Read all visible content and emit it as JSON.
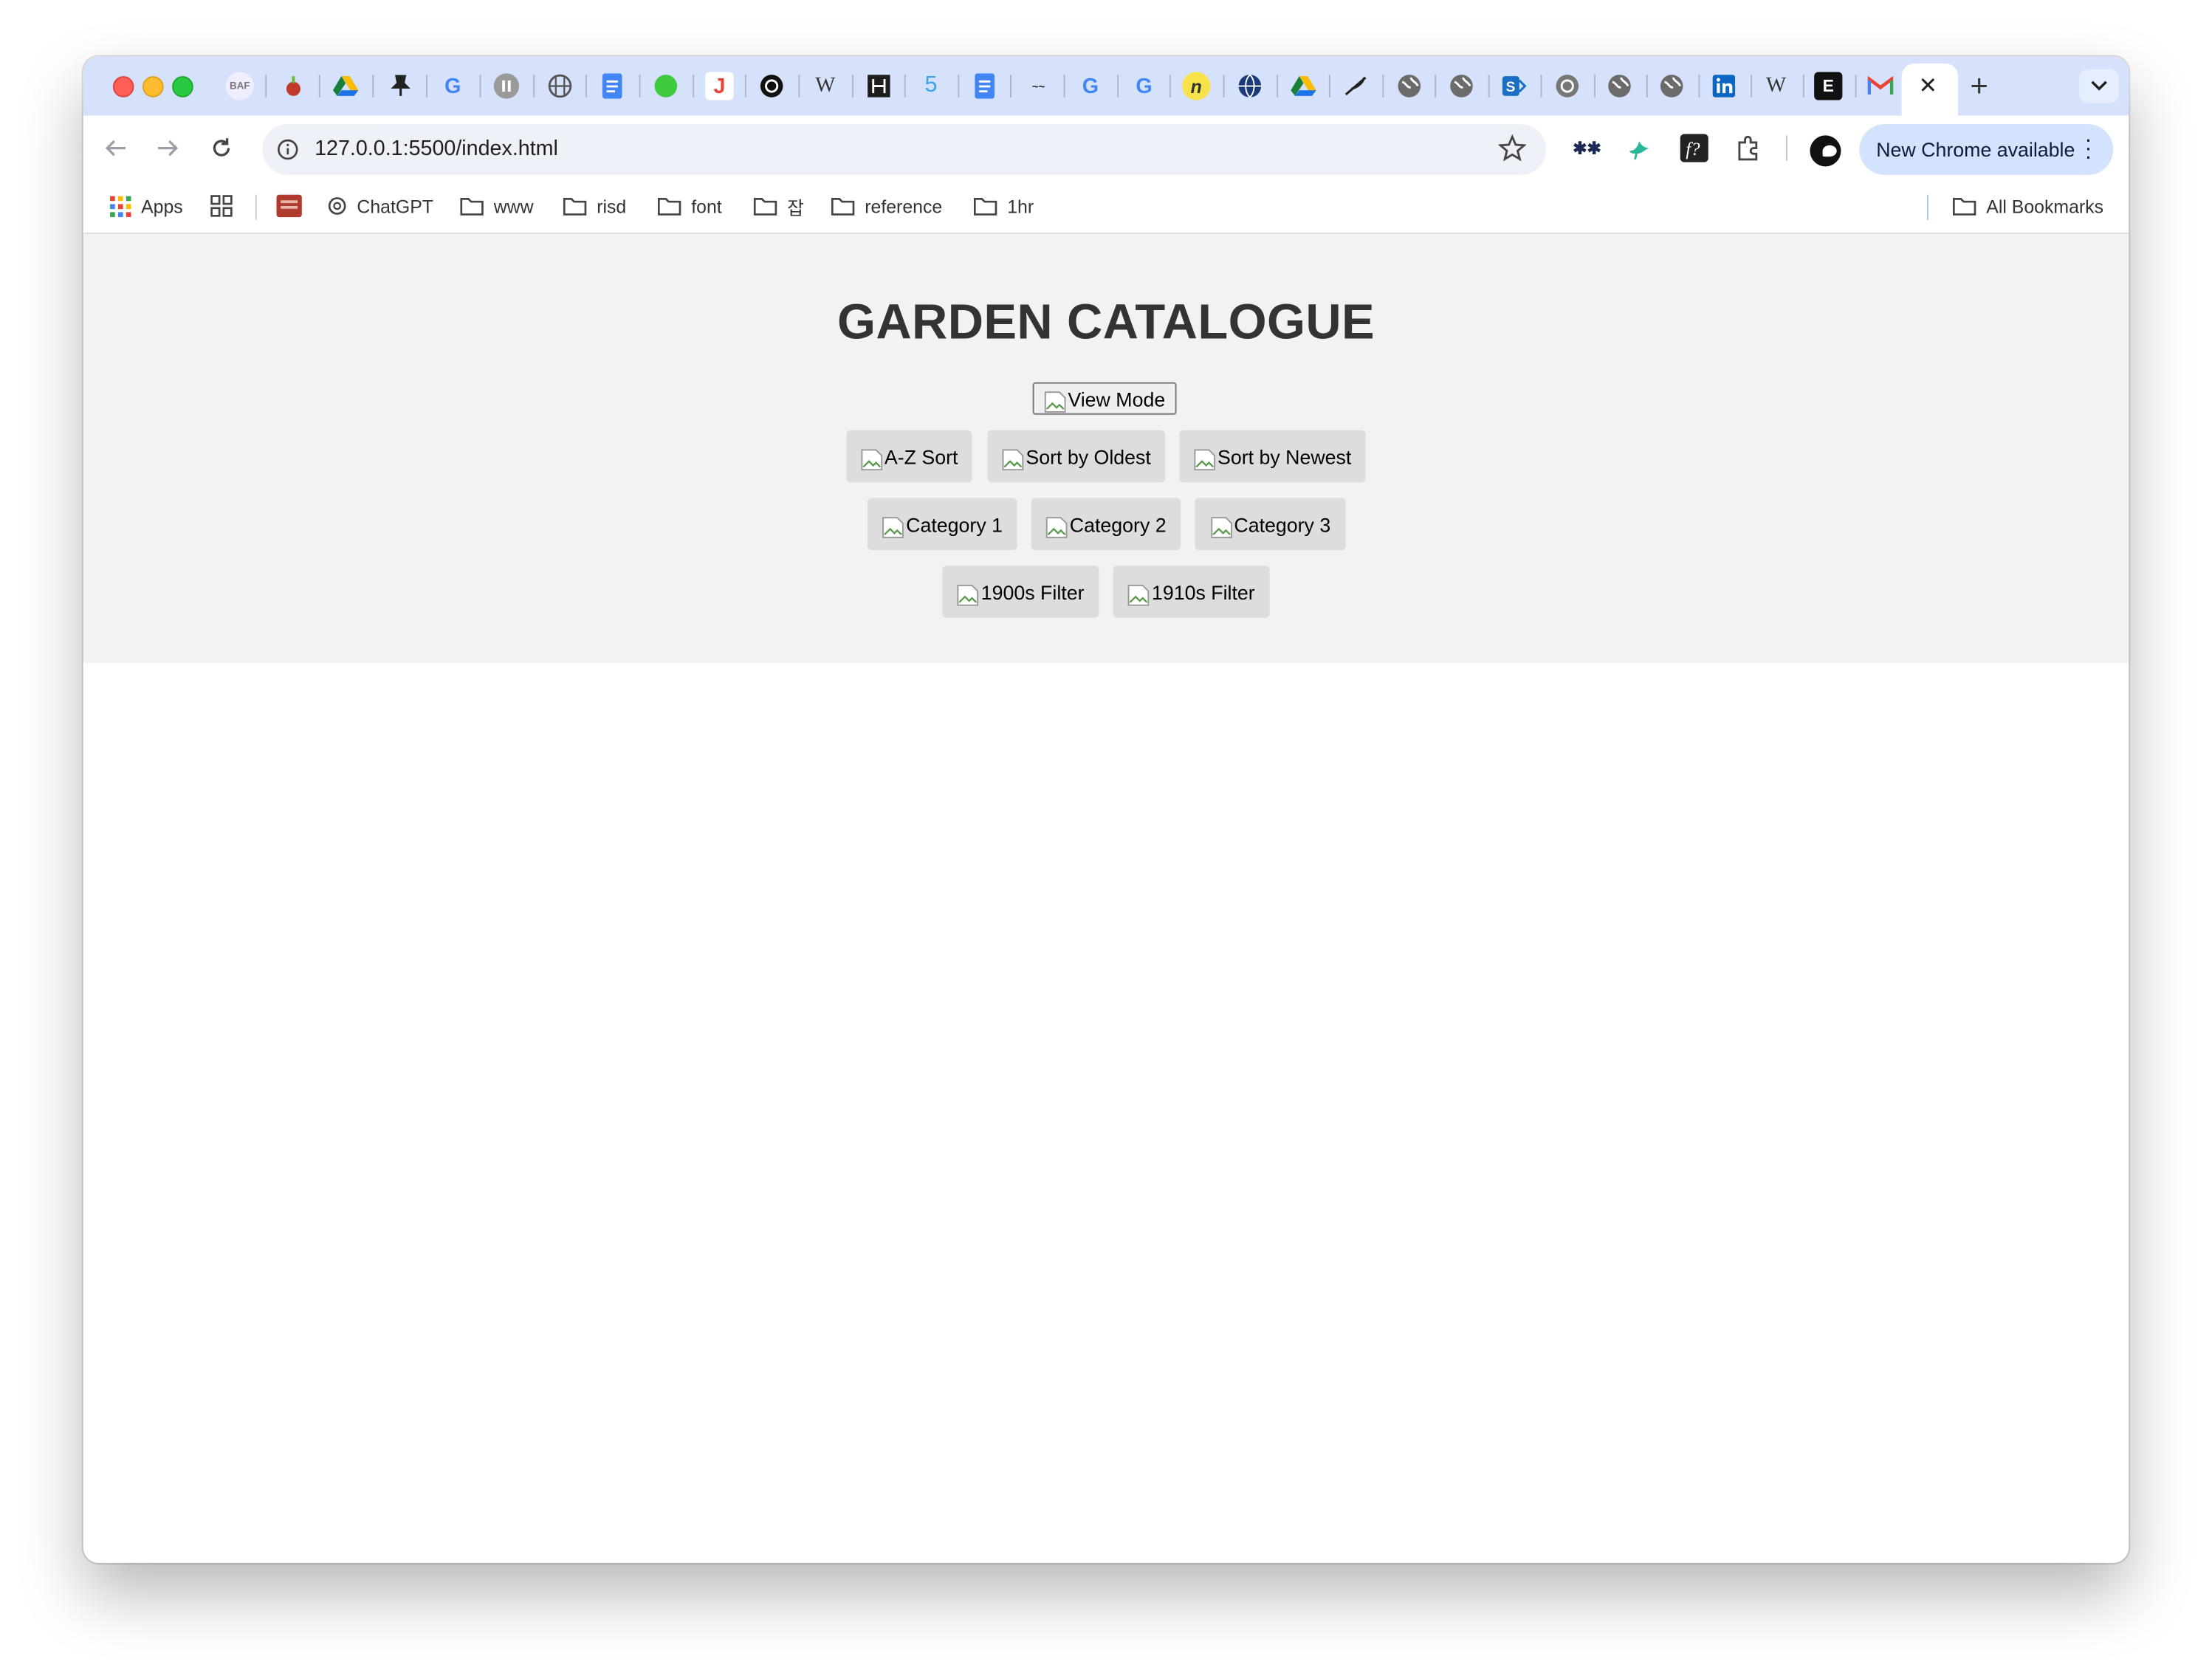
{
  "browser": {
    "address_bar": {
      "url": "127.0.0.1:5500/index.html"
    },
    "update_button": {
      "label": "New Chrome available"
    },
    "bookmarks": {
      "apps": "Apps",
      "chatgpt": "ChatGPT",
      "folders": [
        "www",
        "risd",
        "font",
        "잡",
        "reference",
        "1hr"
      ],
      "all_bookmarks": "All Bookmarks"
    },
    "tab_icons": [
      "baf-icon",
      "apple-icon",
      "google-drive-icon",
      "pin-icon",
      "google-icon",
      "pause-icon",
      "globe-icon",
      "docs-icon",
      "green-dot-icon",
      "j-icon",
      "openai-icon",
      "wikipedia-icon",
      "dark-app-icon",
      "five-icon",
      "docs-icon",
      "app-icon",
      "google-icon",
      "google-icon",
      "nu-icon",
      "globe-icon",
      "google-drive-icon",
      "feather-icon",
      "globe-icon",
      "globe-icon",
      "sharepoint-icon",
      "openai-icon",
      "globe-icon",
      "globe-icon",
      "linkedin-icon",
      "wikipedia-icon",
      "e-icon",
      "gmail-icon"
    ]
  },
  "page": {
    "title": "GARDEN CATALOGUE",
    "view_mode_label": "View Mode",
    "sort_buttons": [
      "A-Z Sort",
      "Sort by Oldest",
      "Sort by Newest"
    ],
    "category_buttons": [
      "Category 1",
      "Category 2",
      "Category 3"
    ],
    "filter_buttons": [
      "1900s Filter",
      "1910s Filter"
    ]
  }
}
